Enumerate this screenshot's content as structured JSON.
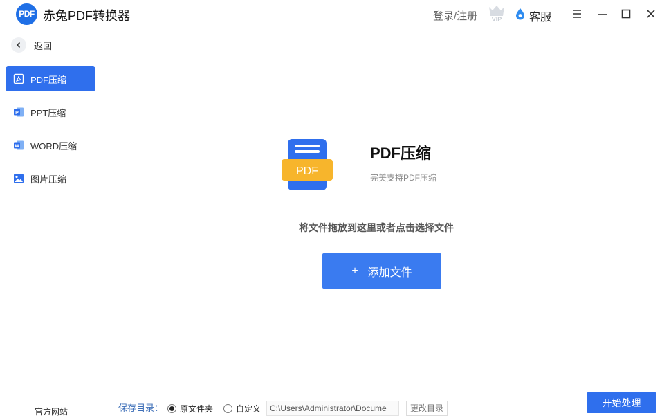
{
  "app": {
    "logo_text": "PDF",
    "title": "赤兔PDF转换器",
    "login": "登录/注册",
    "vip_text": "VIP",
    "service": "客服",
    "window_controls": [
      "menu-icon",
      "minimize-icon",
      "maximize-icon",
      "close-icon"
    ]
  },
  "sidebar": {
    "back_label": "返回",
    "items": [
      {
        "label": "PDF压缩",
        "icon": "pdf-icon",
        "active": true
      },
      {
        "label": "PPT压缩",
        "icon": "ppt-icon",
        "active": false
      },
      {
        "label": "WORD压缩",
        "icon": "word-icon",
        "active": false
      },
      {
        "label": "图片压缩",
        "icon": "image-icon",
        "active": false
      }
    ],
    "official_site": "官方网站"
  },
  "main": {
    "icon_text": "PDF",
    "title": "PDF压缩",
    "subtitle": "完美支持PDF压缩",
    "drop_hint": "将文件拖放到这里或者点击选择文件",
    "add_plus": "+",
    "add_label": "添加文件"
  },
  "footer": {
    "save_label": "保存目录：",
    "option_original": "原文件夹",
    "option_custom": "自定义",
    "selected_option": "原文件夹",
    "path_value": "C:\\Users\\Administrator\\Docume",
    "change_dir": "更改目录",
    "start": "开始处理"
  },
  "colors": {
    "accent": "#2f6fed",
    "button": "#3a7bf0",
    "icon_yellow": "#f7b52c",
    "icon_blue": "#2f6fed"
  }
}
